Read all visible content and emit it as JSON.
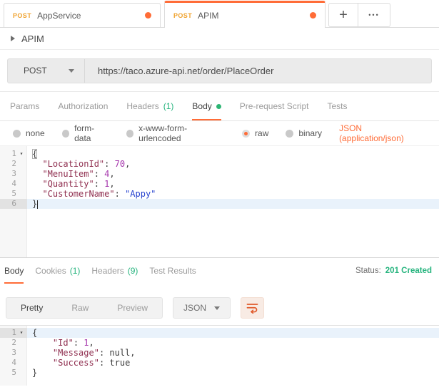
{
  "colors": {
    "accent": "#ff6c37",
    "green": "#26b47e",
    "method_label": "#f0a330"
  },
  "tabstrip": {
    "tabs": [
      {
        "method": "POST",
        "name": "AppService",
        "active": false
      },
      {
        "method": "POST",
        "name": "APIM",
        "active": true
      }
    ],
    "new_tab_label": "+",
    "more_label": "•••"
  },
  "collection": {
    "label": "APIM"
  },
  "request": {
    "method": "POST",
    "url": "https://taco.azure-api.net/order/PlaceOrder",
    "tabs": [
      {
        "label": "Params"
      },
      {
        "label": "Authorization"
      },
      {
        "label": "Headers",
        "count": "(1)"
      },
      {
        "label": "Body",
        "active": true
      },
      {
        "label": "Pre-request Script"
      },
      {
        "label": "Tests"
      }
    ],
    "body_modes": [
      "none",
      "form-data",
      "x-www-form-urlencoded",
      "raw",
      "binary"
    ],
    "selected_mode": "raw",
    "content_type": "JSON (application/json)",
    "editor": {
      "lines": [
        {
          "n": "1",
          "fold": true,
          "tokens": [
            [
              "match",
              "{"
            ]
          ]
        },
        {
          "n": "2",
          "tokens": [
            [
              "punc",
              "  "
            ],
            [
              "key",
              "\"LocationId\""
            ],
            [
              "punc",
              ": "
            ],
            [
              "num",
              "70"
            ],
            [
              "punc",
              ","
            ]
          ]
        },
        {
          "n": "3",
          "tokens": [
            [
              "punc",
              "  "
            ],
            [
              "key",
              "\"MenuItem\""
            ],
            [
              "punc",
              ": "
            ],
            [
              "num",
              "4"
            ],
            [
              "punc",
              ","
            ]
          ]
        },
        {
          "n": "4",
          "tokens": [
            [
              "punc",
              "  "
            ],
            [
              "key",
              "\"Quantity\""
            ],
            [
              "punc",
              ": "
            ],
            [
              "num",
              "1"
            ],
            [
              "punc",
              ","
            ]
          ]
        },
        {
          "n": "5",
          "tokens": [
            [
              "punc",
              "  "
            ],
            [
              "key",
              "\"CustomerName\""
            ],
            [
              "punc",
              ": "
            ],
            [
              "str",
              "\"Appy\""
            ]
          ]
        },
        {
          "n": "6",
          "active": true,
          "hl": true,
          "cursor": true,
          "tokens": [
            [
              "punc",
              "}"
            ]
          ]
        }
      ]
    }
  },
  "response": {
    "tabs": [
      {
        "label": "Body",
        "active": true
      },
      {
        "label": "Cookies",
        "count": "(1)"
      },
      {
        "label": "Headers",
        "count": "(9)"
      },
      {
        "label": "Test Results"
      }
    ],
    "status_label": "Status:",
    "status_value": "201 Created",
    "views": [
      "Pretty",
      "Raw",
      "Preview"
    ],
    "active_view": "Pretty",
    "format": "JSON",
    "editor": {
      "lines": [
        {
          "n": "1",
          "fold": true,
          "active": true,
          "hl": true,
          "tokens": [
            [
              "punc",
              "{"
            ]
          ]
        },
        {
          "n": "2",
          "tokens": [
            [
              "punc",
              "    "
            ],
            [
              "key",
              "\"Id\""
            ],
            [
              "punc",
              ": "
            ],
            [
              "num",
              "1"
            ],
            [
              "punc",
              ","
            ]
          ]
        },
        {
          "n": "3",
          "tokens": [
            [
              "punc",
              "    "
            ],
            [
              "key",
              "\"Message\""
            ],
            [
              "punc",
              ": "
            ],
            [
              "atom",
              "null"
            ],
            [
              "punc",
              ","
            ]
          ]
        },
        {
          "n": "4",
          "tokens": [
            [
              "punc",
              "    "
            ],
            [
              "key",
              "\"Success\""
            ],
            [
              "punc",
              ": "
            ],
            [
              "atom",
              "true"
            ]
          ]
        },
        {
          "n": "5",
          "tokens": [
            [
              "punc",
              "}"
            ]
          ]
        }
      ]
    }
  }
}
